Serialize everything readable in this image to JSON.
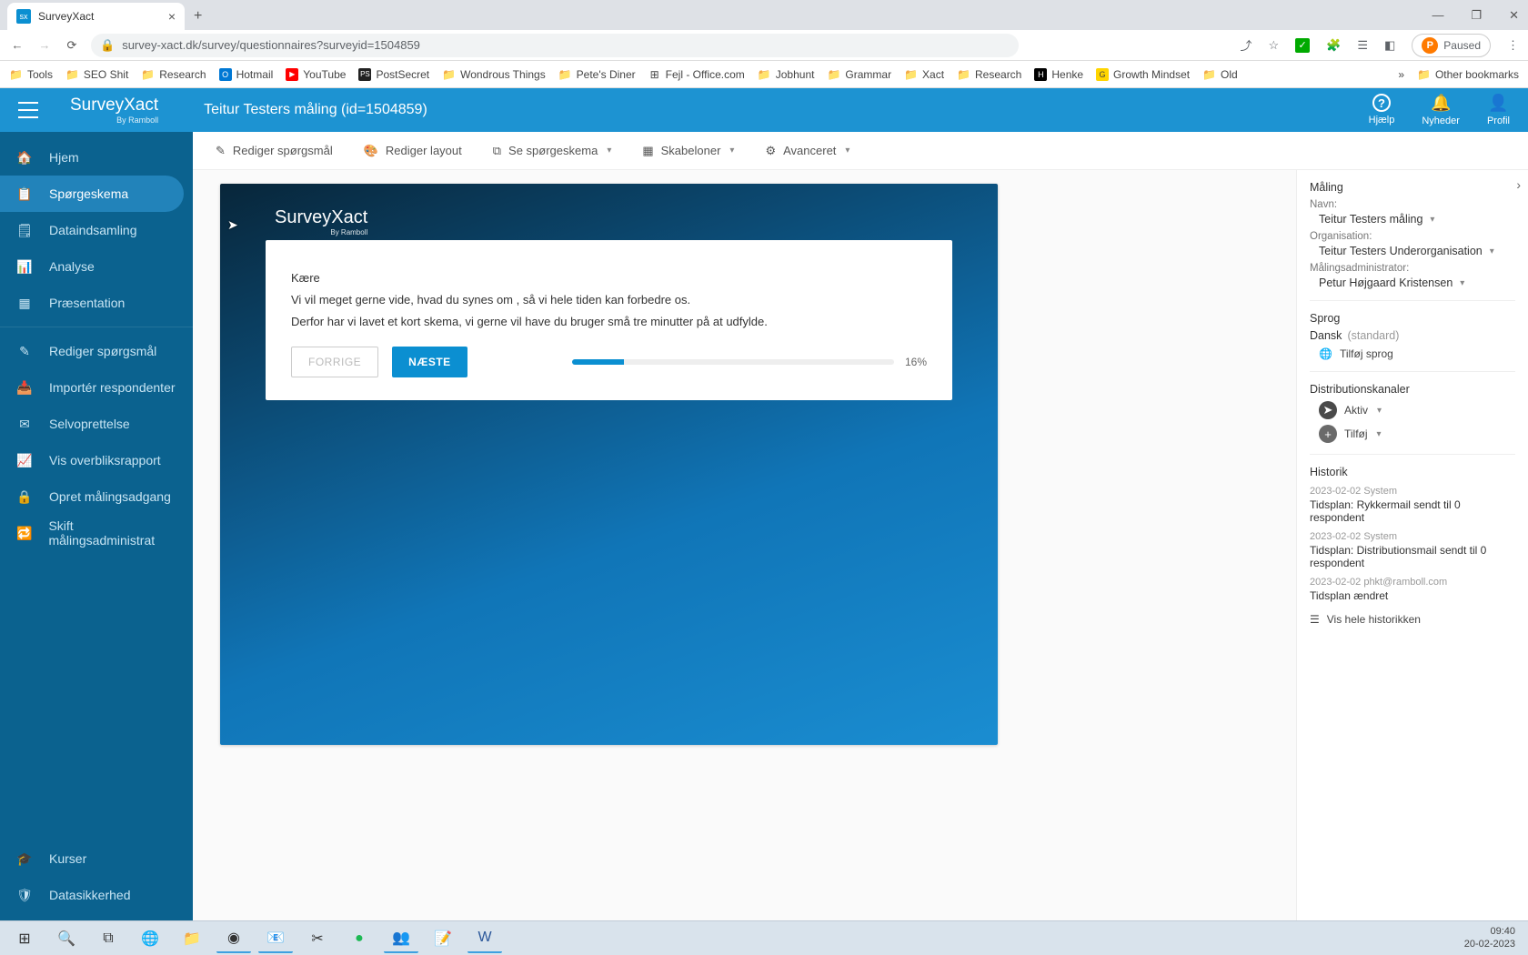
{
  "browser": {
    "tab_title": "SurveyXact",
    "url": "survey-xact.dk/survey/questionnaires?surveyid=1504859",
    "paused_label": "Paused",
    "other_bookmarks": "Other bookmarks"
  },
  "bookmarks": [
    {
      "label": "Tools",
      "type": "folder"
    },
    {
      "label": "SEO Shit",
      "type": "folder"
    },
    {
      "label": "Research",
      "type": "folder"
    },
    {
      "label": "Hotmail",
      "type": "outlook"
    },
    {
      "label": "YouTube",
      "type": "youtube"
    },
    {
      "label": "PostSecret",
      "type": "ps"
    },
    {
      "label": "Wondrous Things",
      "type": "folder"
    },
    {
      "label": "Pete's Diner",
      "type": "folder"
    },
    {
      "label": "Fejl - Office.com",
      "type": "ms"
    },
    {
      "label": "Jobhunt",
      "type": "folder"
    },
    {
      "label": "Grammar",
      "type": "folder"
    },
    {
      "label": "Xact",
      "type": "folder"
    },
    {
      "label": "Research",
      "type": "folder"
    },
    {
      "label": "Henke",
      "type": "dark"
    },
    {
      "label": "Growth Mindset",
      "type": "yellow"
    },
    {
      "label": "Old",
      "type": "folder"
    }
  ],
  "app": {
    "logo_main": "SurveyXact",
    "logo_sub": "By Ramboll",
    "title": "Teitur Testers måling (id=1504859)",
    "header_buttons": {
      "help": "Hjælp",
      "news": "Nyheder",
      "profile": "Profil"
    }
  },
  "sidebar": {
    "items": [
      {
        "label": "Hjem",
        "icon": "home"
      },
      {
        "label": "Spørgeskema",
        "icon": "clipboard",
        "active": true
      },
      {
        "label": "Dataindsamling",
        "icon": "clipboard2"
      },
      {
        "label": "Analyse",
        "icon": "bars"
      },
      {
        "label": "Præsentation",
        "icon": "grid"
      }
    ],
    "items2": [
      {
        "label": "Rediger spørgsmål",
        "icon": "pencil"
      },
      {
        "label": "Importér respondenter",
        "icon": "import"
      },
      {
        "label": "Selvoprettelse",
        "icon": "mail"
      },
      {
        "label": "Vis overbliksrapport",
        "icon": "chart"
      },
      {
        "label": "Opret målingsadgang",
        "icon": "lock"
      },
      {
        "label": "Skift målingsadministrat",
        "icon": "swap"
      }
    ],
    "items3": [
      {
        "label": "Kurser",
        "icon": "school"
      },
      {
        "label": "Datasikkerhed",
        "icon": "shield"
      }
    ]
  },
  "toolbar": {
    "edit_q": "Rediger spørgsmål",
    "edit_layout": "Rediger layout",
    "view_survey": "Se spørgeskema",
    "templates": "Skabeloner",
    "advanced": "Avanceret"
  },
  "survey": {
    "logo_main": "SurveyXact",
    "logo_sub": "By Ramboll",
    "greeting": "Kære",
    "line1": "Vi vil meget gerne vide, hvad du synes om , så vi hele tiden kan forbedre os.",
    "line2": "Derfor har vi lavet et kort skema, vi gerne vil have du bruger små tre minutter på at udfylde.",
    "prev": "FORRIGE",
    "next": "NÆSTE",
    "progress_pct": "16%",
    "progress_value": 16
  },
  "right_panel": {
    "section_measurement": "Måling",
    "name_label": "Navn:",
    "name_value": "Teitur Testers måling",
    "org_label": "Organisation:",
    "org_value": "Teitur Testers Underorganisation",
    "admin_label": "Målingsadministrator:",
    "admin_value": "Petur Højgaard Kristensen",
    "section_lang": "Sprog",
    "lang_value": "Dansk",
    "lang_std": "(standard)",
    "add_lang": "Tilføj sprog",
    "section_dist": "Distributionskanaler",
    "dist_active": "Aktiv",
    "dist_add": "Tilføj",
    "section_hist": "Historik",
    "history": [
      {
        "meta": "2023-02-02   System",
        "text": "Tidsplan: Rykkermail sendt til 0 respondent"
      },
      {
        "meta": "2023-02-02   System",
        "text": "Tidsplan: Distributionsmail sendt til 0 respondent"
      },
      {
        "meta": "2023-02-02   phkt@ramboll.com",
        "text": "Tidsplan ændret"
      }
    ],
    "show_all_hist": "Vis hele historikken"
  },
  "taskbar": {
    "time": "09:40",
    "date": "20-02-2023"
  }
}
